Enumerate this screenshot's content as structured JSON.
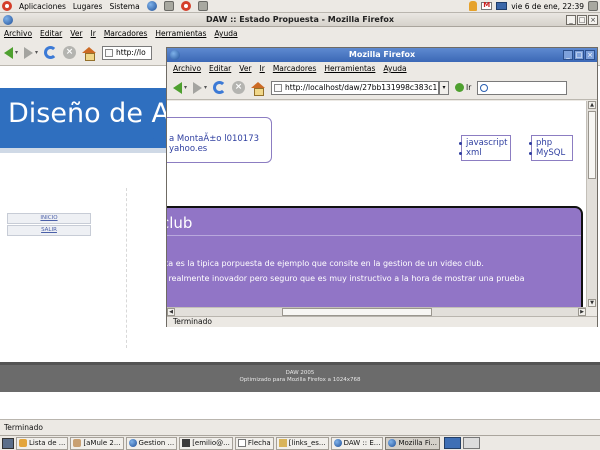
{
  "top_panel": {
    "menus": [
      "Aplicaciones",
      "Lugares",
      "Sistema"
    ],
    "clock": "vie  6 de ene, 22:39"
  },
  "outer_window": {
    "title": "DAW :: Estado Propuesta - Mozilla Firefox",
    "menu": [
      "Archivo",
      "Editar",
      "Ver",
      "Ir",
      "Marcadores",
      "Herramientas",
      "Ayuda"
    ],
    "url": "http://lo",
    "status": "Terminado"
  },
  "site": {
    "title": "Diseño de A",
    "nav": [
      "INICIO",
      "SALIR"
    ],
    "footer_line1": "DAW 2005",
    "footer_line2": "Optimizado para Mozilla Firefox a 1024x768"
  },
  "popup_window": {
    "title": "Mozilla Firefox",
    "menu": [
      "Archivo",
      "Editar",
      "Ver",
      "Ir",
      "Marcadores",
      "Herramientas",
      "Ayuda"
    ],
    "url": "http://localhost/daw/27bb131998c383c1",
    "go_label": "Ir",
    "search_placeholder": "",
    "status": "Terminado"
  },
  "popup_page": {
    "contact_line1": "a MontaÃ±o l010173",
    "contact_line2": "yahoo.es",
    "tags_a": [
      "javascript",
      "xml"
    ],
    "tags_b": [
      "php",
      "MySQL"
    ],
    "club_title": "club",
    "club_line1": "sta es la tipica porpuesta de ejemplo que consite en la gestion de un video club.",
    "club_line2": "a realmente inovador pero seguro que es muy instructivo a la hora de mostrar una prueba"
  },
  "taskbar": {
    "items": [
      {
        "label": "Lista de ...",
        "icon": "dog-icon"
      },
      {
        "label": "[aMule 2...",
        "icon": "mule-icon"
      },
      {
        "label": "Gestion ...",
        "icon": "firefox-icon"
      },
      {
        "label": "[emilio@...",
        "icon": "terminal-icon"
      },
      {
        "label": "Flecha",
        "icon": "document-icon"
      },
      {
        "label": "[links_es...",
        "icon": "folder-icon"
      },
      {
        "label": "DAW :: E...",
        "icon": "firefox-icon"
      },
      {
        "label": "Mozilla Fi...",
        "icon": "firefox-icon"
      }
    ]
  },
  "colors": {
    "site_header_blue": "#2f6fbf",
    "club_purple": "#9175c6",
    "link_blue": "#2f3fa0",
    "popup_titlebar": "#3b68b6"
  }
}
